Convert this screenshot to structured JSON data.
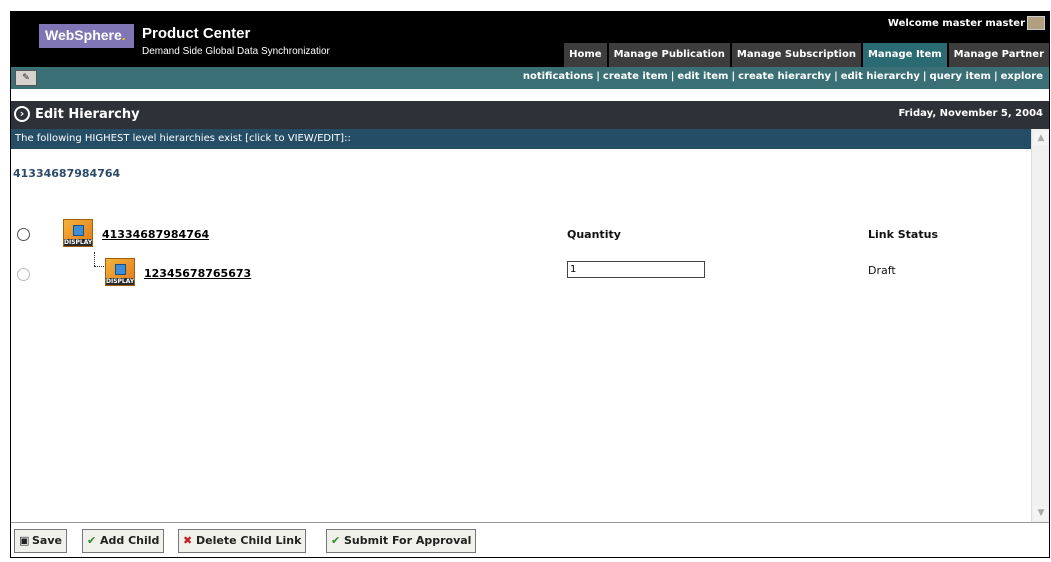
{
  "brand": {
    "name": "WebSphere",
    "dot": ".",
    "product": "Product Center",
    "subtitle": "Demand Side Global Data Synchronizatior"
  },
  "header": {
    "welcome": "Welcome master master",
    "tabs": [
      {
        "label": "Home"
      },
      {
        "label": "Manage Publication"
      },
      {
        "label": "Manage Subscription"
      },
      {
        "label": "Manage Item"
      },
      {
        "label": "Manage Partner"
      }
    ]
  },
  "nav": {
    "links": [
      "notifications",
      "create item",
      "edit item",
      "create hierarchy",
      "edit hierarchy",
      "query item",
      "explore"
    ]
  },
  "page": {
    "title": "Edit Hierarchy",
    "date": "Friday, November 5, 2004"
  },
  "notice": "The following HIGHEST level hierarchies exist [click to VIEW/EDIT]::",
  "root_link": "41334687984764",
  "table": {
    "col_quantity": "Quantity",
    "col_link_status": "Link Status",
    "icon_label": "DISPLAY",
    "parent": {
      "id": "41334687984764"
    },
    "child": {
      "id": "12345678765673",
      "quantity": "1",
      "status": "Draft"
    }
  },
  "footer": {
    "save": "Save",
    "add_child": "Add Child",
    "delete_child_link": "Delete Child Link",
    "submit": "Submit For Approval"
  },
  "colors": {
    "header_bg": "#000000",
    "nav_bg": "#3a6f76",
    "notice_bg": "#254e66",
    "brand_bg": "#8076b6",
    "active_tab": "#2a6b73"
  }
}
